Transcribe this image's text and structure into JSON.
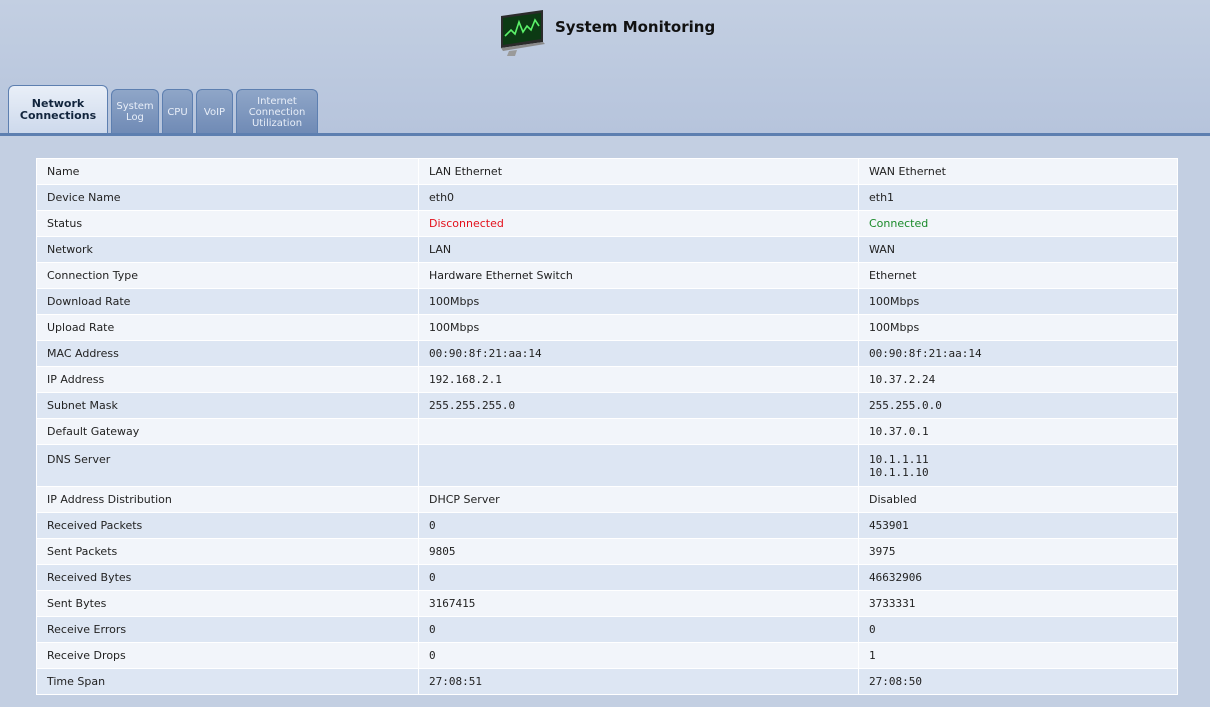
{
  "page": {
    "title": "System Monitoring",
    "icon": "monitor-chart-icon"
  },
  "tabs": [
    {
      "label": "Network\nConnections",
      "active": true
    },
    {
      "label": "System\nLog",
      "active": false
    },
    {
      "label": "CPU",
      "active": false
    },
    {
      "label": "VoIP",
      "active": false
    },
    {
      "label": "Internet\nConnection\nUtilization",
      "active": false
    }
  ],
  "colors": {
    "header_bg": "#c3cfe2",
    "tab_inactive": "#7f98bf",
    "row_light": "#f2f5fa",
    "row_dark": "#dde6f3",
    "status_disconnected": "#e3101b",
    "status_connected": "#1a8a2a"
  },
  "table": {
    "rows": [
      {
        "name": "Name",
        "lan": "LAN Ethernet",
        "wan": "WAN Ethernet"
      },
      {
        "name": "Device Name",
        "lan": "eth0",
        "wan": "eth1"
      },
      {
        "name": "Status",
        "lan": "Disconnected",
        "wan": "Connected"
      },
      {
        "name": "Network",
        "lan": "LAN",
        "wan": "WAN"
      },
      {
        "name": "Connection Type",
        "lan": "Hardware Ethernet Switch",
        "wan": "Ethernet"
      },
      {
        "name": "Download Rate",
        "lan": "100Mbps",
        "wan": "100Mbps"
      },
      {
        "name": "Upload Rate",
        "lan": "100Mbps",
        "wan": "100Mbps"
      },
      {
        "name": "MAC Address",
        "lan": "00:90:8f:21:aa:14",
        "wan": "00:90:8f:21:aa:14"
      },
      {
        "name": "IP Address",
        "lan": "192.168.2.1",
        "wan": "10.37.2.24"
      },
      {
        "name": "Subnet Mask",
        "lan": "255.255.255.0",
        "wan": "255.255.0.0"
      },
      {
        "name": "Default Gateway",
        "lan": "",
        "wan": "10.37.0.1"
      },
      {
        "name": "DNS Server",
        "lan": "",
        "wan": "10.1.1.11",
        "wan2": "10.1.1.10"
      },
      {
        "name": "IP Address Distribution",
        "lan": "DHCP Server",
        "wan": "Disabled"
      },
      {
        "name": "Received Packets",
        "lan": "0",
        "wan": "453901"
      },
      {
        "name": "Sent Packets",
        "lan": "9805",
        "wan": "3975"
      },
      {
        "name": "Received Bytes",
        "lan": "0",
        "wan": "46632906"
      },
      {
        "name": "Sent Bytes",
        "lan": "3167415",
        "wan": "3733331"
      },
      {
        "name": "Receive Errors",
        "lan": "0",
        "wan": "0"
      },
      {
        "name": "Receive Drops",
        "lan": "0",
        "wan": "1"
      },
      {
        "name": "Time Span",
        "lan": "27:08:51",
        "wan": "27:08:50"
      }
    ]
  }
}
